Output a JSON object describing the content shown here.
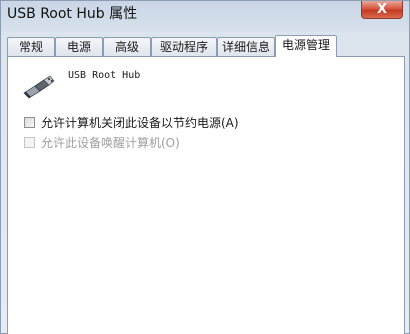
{
  "window": {
    "title": "USB Root Hub 属性",
    "close_symbol": "X"
  },
  "tabs": [
    {
      "label": "常规",
      "active": false
    },
    {
      "label": "电源",
      "active": false
    },
    {
      "label": "高级",
      "active": false
    },
    {
      "label": "驱动程序",
      "active": false
    },
    {
      "label": "详细信息",
      "active": false
    },
    {
      "label": "电源管理",
      "active": true
    }
  ],
  "device": {
    "name": "USB Root Hub",
    "icon": "usb-plug-icon"
  },
  "options": [
    {
      "label": "允许计算机关闭此设备以节约电源(A)",
      "checked": false,
      "enabled": true
    },
    {
      "label": "允许此设备唤醒计算机(O)",
      "checked": false,
      "enabled": false
    }
  ]
}
